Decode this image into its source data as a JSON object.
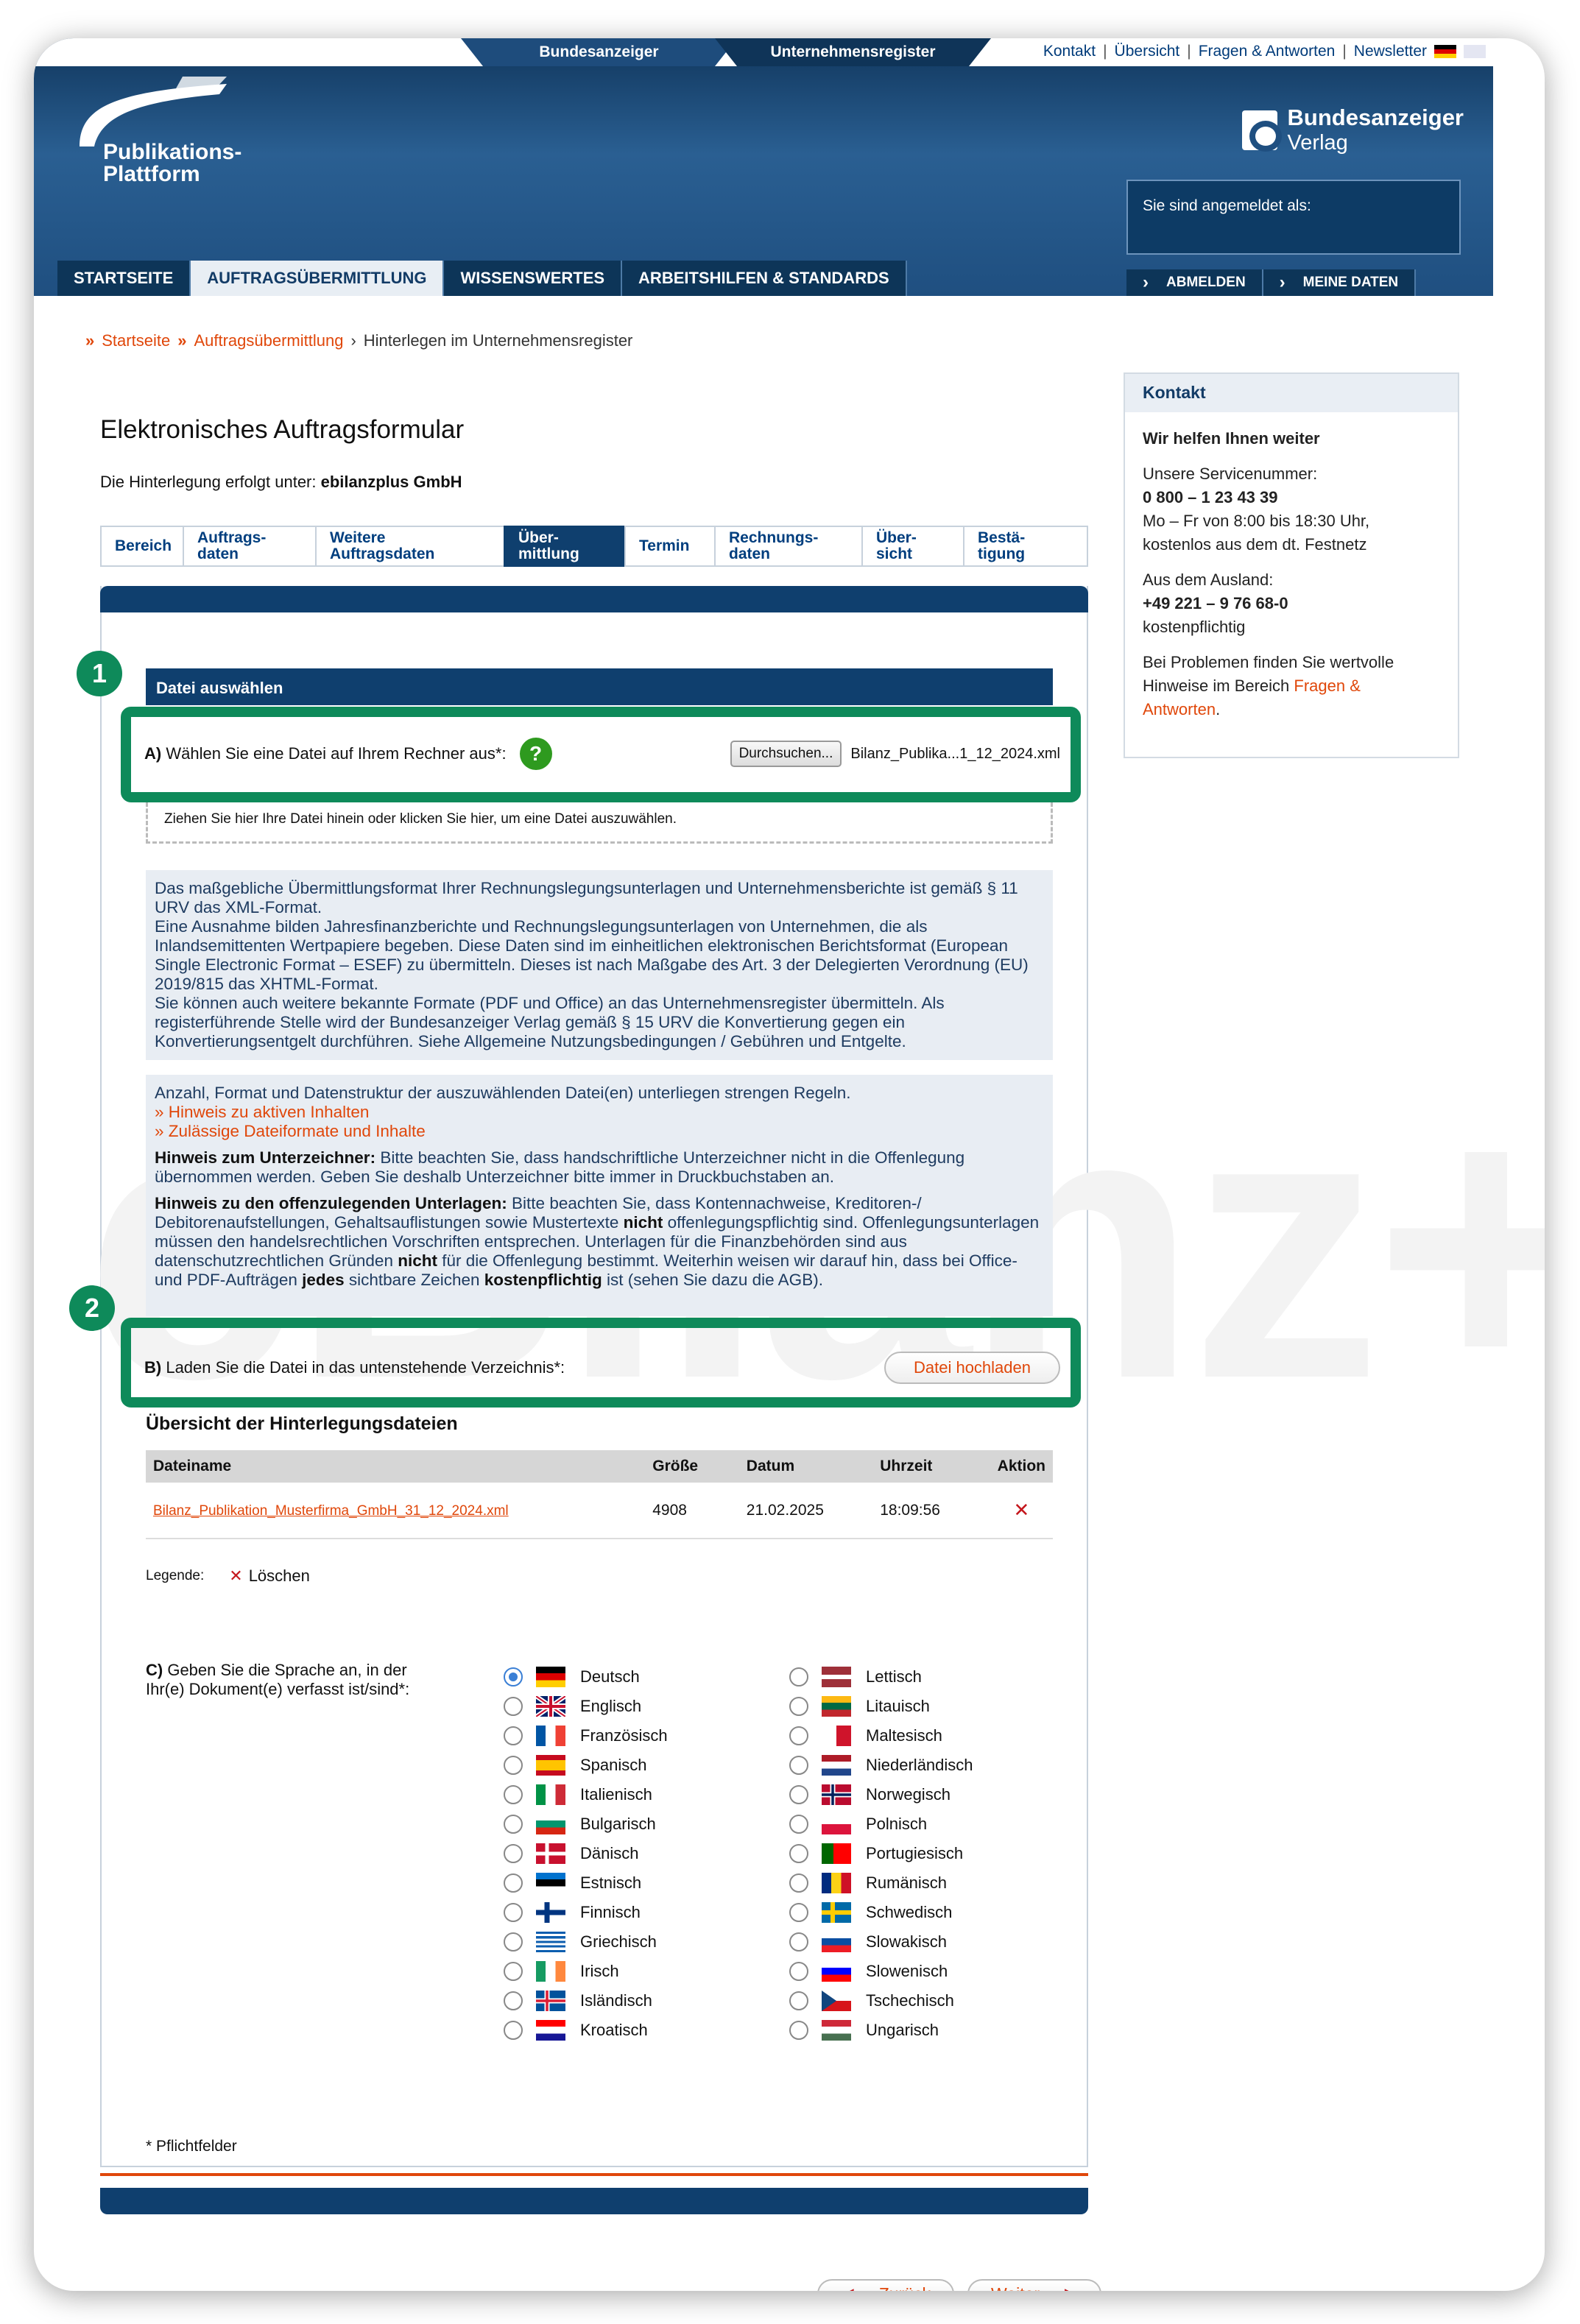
{
  "header": {
    "tab_bundesanzeiger": "Bundesanzeiger",
    "tab_unternehmensregister": "Unternehmensregister",
    "top_links": [
      "Kontakt",
      "Übersicht",
      "Fragen & Antworten",
      "Newsletter"
    ],
    "logo_line1": "Publikations-",
    "logo_line2": "Plattform",
    "publisher_line1": "Bundesanzeiger",
    "publisher_line2": "Verlag",
    "login_text": "Sie sind angemeldet als:",
    "nav": [
      "STARTSEITE",
      "AUFTRAGSÜBERMITTLUNG",
      "WISSENSWERTES",
      "ARBEITSHILFEN & STANDARDS"
    ],
    "account": [
      "ABMELDEN",
      "MEINE DATEN"
    ]
  },
  "breadcrumb": {
    "items": [
      "Startseite",
      "Auftragsübermittlung"
    ],
    "current": "Hinterlegen im Unternehmensregister"
  },
  "kontakt": {
    "title": "Kontakt",
    "subtitle": "Wir helfen Ihnen weiter",
    "service_label": "Unsere Servicenummer:",
    "service_number": "0 800 – 1 23 43 39",
    "service_hours": "Mo – Fr von 8:00 bis 18:30 Uhr, kostenlos aus dem dt. Festnetz",
    "abroad_label": "Aus dem Ausland:",
    "abroad_number": "+49 221 – 9 76 68-0",
    "abroad_cost": "kostenpflichtig",
    "problems_text": "Bei Problemen finden Sie wertvolle Hinweise im Bereich",
    "problems_link": "Fragen & Antworten",
    "problems_end": "."
  },
  "form": {
    "title": "Elektronisches Auftragsformular",
    "sub_prefix": "Die Hinterlegung erfolgt unter: ",
    "sub_company": "ebilanzplus GmbH",
    "steps": [
      {
        "l1": "Bereich",
        "l2": ""
      },
      {
        "l1": "Auftrags-",
        "l2": "daten"
      },
      {
        "l1": "Weitere",
        "l2": "Auftragsdaten"
      },
      {
        "l1": "Über-",
        "l2": "mittlung"
      },
      {
        "l1": "Termin",
        "l2": ""
      },
      {
        "l1": "Rechnungs-",
        "l2": "daten"
      },
      {
        "l1": "Über-",
        "l2": "sicht"
      },
      {
        "l1": "Bestä-",
        "l2": "tigung"
      }
    ],
    "watermark": "eBilanz+",
    "marker1": "1",
    "marker2": "2",
    "section_title": "Datei auswählen",
    "a_label_bold": "A)",
    "a_label": " Wählen Sie eine Datei auf Ihrem Rechner aus*:",
    "help": "?",
    "browse_button": "Durchsuchen...",
    "chosen_file": "Bilanz_Publika...1_12_2024.xml",
    "drop_text": "Ziehen Sie hier Ihre Datei hinein oder klicken Sie hier, um eine Datei auszuwählen.",
    "info1": [
      "Das maßgebliche Übermittlungsformat Ihrer Rechnungslegungsunterlagen und Unternehmensberichte ist gemäß § 11 URV das XML-Format.",
      "Eine Ausnahme bilden Jahresfinanzberichte und Rechnungslegungsunterlagen von Unternehmen, die als Inlandsemittenten Wertpapiere begeben. Diese Daten sind im einheitlichen elektronischen Berichtsformat (European Single Electronic Format – ESEF) zu übermitteln. Dieses ist nach Maßgabe des Art. 3 der Delegierten Verordnung (EU) 2019/815 das XHTML-Format.",
      "Sie können auch weitere bekannte Formate (PDF und Office) an das Unternehmensregister übermitteln. Als registerführende Stelle wird der Bundesanzeiger Verlag gemäß § 15 URV die Konvertierung gegen ein Konvertierungsentgelt durchführen. Siehe Allgemeine Nutzungsbedingungen / Gebühren und Entgelte."
    ],
    "info2_intro": "Anzahl, Format und Datenstruktur der auszuwählenden Datei(en) unterliegen strengen Regeln.",
    "info2_link1": "» Hinweis zu aktiven Inhalten",
    "info2_link2": "» Zulässige Dateiformate und Inhalte",
    "signer_bold": "Hinweis zum Unterzeichner:",
    "signer_text": " Bitte beachten Sie, dass handschriftliche Unterzeichner nicht in die Offenlegung übernommen werden. Geben Sie deshalb Unterzeichner bitte immer in Druckbuchstaben an.",
    "docs_bold": "Hinweis zu den offenzulegenden Unterlagen:",
    "docs_text1": " Bitte beachten Sie, dass Kontennachweise, Kreditoren-/ Debitorenaufstellungen, Gehaltsauflistungen sowie Mustertexte ",
    "docs_nicht1": "nicht",
    "docs_text2": " offenlegungspflichtig sind. Offenlegungsunterlagen müssen den handelsrechtlichen Vorschriften entsprechen. Unterlagen für die Finanzbehörden sind aus datenschutzrechtlichen Gründen ",
    "docs_nicht2": "nicht",
    "docs_text3": " für die Offenlegung bestimmt. Weiterhin weisen wir darauf hin, dass bei Office- und PDF-Aufträgen ",
    "docs_jedes": "jedes",
    "docs_text4": " sichtbare Zeichen ",
    "docs_kosten": "kostenpflichtig",
    "docs_text5": " ist (sehen Sie dazu die AGB).",
    "b_label_bold": "B)",
    "b_label": " Laden Sie die Datei in das untenstehende Verzeichnis*:",
    "upload_button": "Datei hochladen",
    "overview_title": "Übersicht der Hinterlegungsdateien",
    "table": {
      "headers": [
        "Dateiname",
        "Größe",
        "Datum",
        "Uhrzeit",
        "Aktion"
      ],
      "rows": [
        {
          "name": "Bilanz_Publikation_Musterfirma_GmbH_31_12_2024.xml",
          "size": "4908",
          "date": "21.02.2025",
          "time": "18:09:56",
          "action": "✕"
        }
      ]
    },
    "legend_label": "Legende:",
    "legend_delete_icon": "✕",
    "legend_delete": "Löschen",
    "c_bold": "C)",
    "c_label": " Geben Sie die Sprache an, in der Ihr(e) Dokument(e) verfasst ist/sind*:",
    "languages_left": [
      "Deutsch",
      "Englisch",
      "Französisch",
      "Spanisch",
      "Italienisch",
      "Bulgarisch",
      "Dänisch",
      "Estnisch",
      "Finnisch",
      "Griechisch",
      "Irisch",
      "Isländisch",
      "Kroatisch"
    ],
    "languages_right": [
      "Lettisch",
      "Litauisch",
      "Maltesisch",
      "Niederländisch",
      "Norwegisch",
      "Polnisch",
      "Portugiesisch",
      "Rumänisch",
      "Schwedisch",
      "Slowakisch",
      "Slowenisch",
      "Tschechisch",
      "Ungarisch"
    ],
    "selected_language": "Deutsch",
    "required_note": "* Pflichtfelder",
    "back_button": "Zurück",
    "next_button": "Weiter"
  },
  "colors": {
    "accent": "#e0470a",
    "navy": "#0f3f6e",
    "green": "#0e8a5a"
  }
}
